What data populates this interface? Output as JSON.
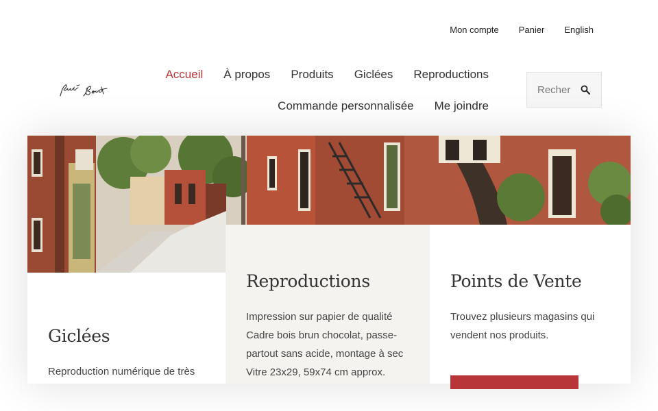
{
  "topbar": {
    "account": "Mon compte",
    "cart": "Panier",
    "language": "English"
  },
  "nav": {
    "row1": [
      "Accueil",
      "À propos",
      "Produits",
      "Giclées",
      "Reproductions"
    ],
    "row2": [
      "Commande personnalisée",
      "Me joindre"
    ],
    "active": "Accueil"
  },
  "search": {
    "placeholder": "Recher"
  },
  "cards": [
    {
      "title": "Giclées",
      "text": "Reproduction numérique de très"
    },
    {
      "title": "Reproductions",
      "text": "Impression sur papier de qualité Cadre bois brun chocolat, passe-partout sans acide, montage à sec Vitre 23x29, 59x74 cm approx."
    },
    {
      "title": "Points de Vente",
      "text": "Trouvez plusieurs magasins qui vendent nos produits."
    }
  ],
  "colors": {
    "accent": "#b8353a",
    "card_alt_bg": "#f5f3ef"
  },
  "icons": {
    "search": "search-icon",
    "logo": "signature-logo"
  }
}
